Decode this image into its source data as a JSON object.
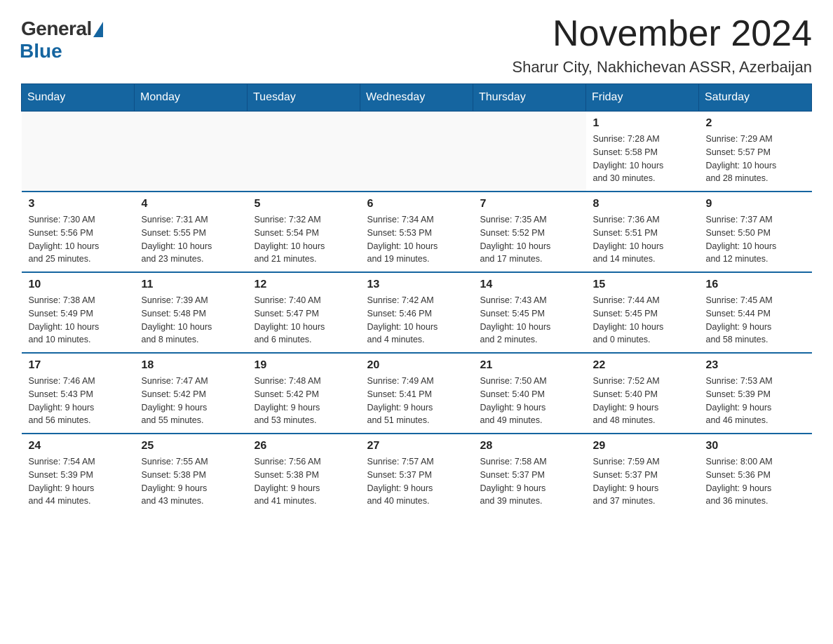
{
  "logo": {
    "general": "General",
    "blue": "Blue"
  },
  "title": "November 2024",
  "subtitle": "Sharur City, Nakhichevan ASSR, Azerbaijan",
  "weekdays": [
    "Sunday",
    "Monday",
    "Tuesday",
    "Wednesday",
    "Thursday",
    "Friday",
    "Saturday"
  ],
  "weeks": [
    [
      {
        "day": "",
        "info": ""
      },
      {
        "day": "",
        "info": ""
      },
      {
        "day": "",
        "info": ""
      },
      {
        "day": "",
        "info": ""
      },
      {
        "day": "",
        "info": ""
      },
      {
        "day": "1",
        "info": "Sunrise: 7:28 AM\nSunset: 5:58 PM\nDaylight: 10 hours\nand 30 minutes."
      },
      {
        "day": "2",
        "info": "Sunrise: 7:29 AM\nSunset: 5:57 PM\nDaylight: 10 hours\nand 28 minutes."
      }
    ],
    [
      {
        "day": "3",
        "info": "Sunrise: 7:30 AM\nSunset: 5:56 PM\nDaylight: 10 hours\nand 25 minutes."
      },
      {
        "day": "4",
        "info": "Sunrise: 7:31 AM\nSunset: 5:55 PM\nDaylight: 10 hours\nand 23 minutes."
      },
      {
        "day": "5",
        "info": "Sunrise: 7:32 AM\nSunset: 5:54 PM\nDaylight: 10 hours\nand 21 minutes."
      },
      {
        "day": "6",
        "info": "Sunrise: 7:34 AM\nSunset: 5:53 PM\nDaylight: 10 hours\nand 19 minutes."
      },
      {
        "day": "7",
        "info": "Sunrise: 7:35 AM\nSunset: 5:52 PM\nDaylight: 10 hours\nand 17 minutes."
      },
      {
        "day": "8",
        "info": "Sunrise: 7:36 AM\nSunset: 5:51 PM\nDaylight: 10 hours\nand 14 minutes."
      },
      {
        "day": "9",
        "info": "Sunrise: 7:37 AM\nSunset: 5:50 PM\nDaylight: 10 hours\nand 12 minutes."
      }
    ],
    [
      {
        "day": "10",
        "info": "Sunrise: 7:38 AM\nSunset: 5:49 PM\nDaylight: 10 hours\nand 10 minutes."
      },
      {
        "day": "11",
        "info": "Sunrise: 7:39 AM\nSunset: 5:48 PM\nDaylight: 10 hours\nand 8 minutes."
      },
      {
        "day": "12",
        "info": "Sunrise: 7:40 AM\nSunset: 5:47 PM\nDaylight: 10 hours\nand 6 minutes."
      },
      {
        "day": "13",
        "info": "Sunrise: 7:42 AM\nSunset: 5:46 PM\nDaylight: 10 hours\nand 4 minutes."
      },
      {
        "day": "14",
        "info": "Sunrise: 7:43 AM\nSunset: 5:45 PM\nDaylight: 10 hours\nand 2 minutes."
      },
      {
        "day": "15",
        "info": "Sunrise: 7:44 AM\nSunset: 5:45 PM\nDaylight: 10 hours\nand 0 minutes."
      },
      {
        "day": "16",
        "info": "Sunrise: 7:45 AM\nSunset: 5:44 PM\nDaylight: 9 hours\nand 58 minutes."
      }
    ],
    [
      {
        "day": "17",
        "info": "Sunrise: 7:46 AM\nSunset: 5:43 PM\nDaylight: 9 hours\nand 56 minutes."
      },
      {
        "day": "18",
        "info": "Sunrise: 7:47 AM\nSunset: 5:42 PM\nDaylight: 9 hours\nand 55 minutes."
      },
      {
        "day": "19",
        "info": "Sunrise: 7:48 AM\nSunset: 5:42 PM\nDaylight: 9 hours\nand 53 minutes."
      },
      {
        "day": "20",
        "info": "Sunrise: 7:49 AM\nSunset: 5:41 PM\nDaylight: 9 hours\nand 51 minutes."
      },
      {
        "day": "21",
        "info": "Sunrise: 7:50 AM\nSunset: 5:40 PM\nDaylight: 9 hours\nand 49 minutes."
      },
      {
        "day": "22",
        "info": "Sunrise: 7:52 AM\nSunset: 5:40 PM\nDaylight: 9 hours\nand 48 minutes."
      },
      {
        "day": "23",
        "info": "Sunrise: 7:53 AM\nSunset: 5:39 PM\nDaylight: 9 hours\nand 46 minutes."
      }
    ],
    [
      {
        "day": "24",
        "info": "Sunrise: 7:54 AM\nSunset: 5:39 PM\nDaylight: 9 hours\nand 44 minutes."
      },
      {
        "day": "25",
        "info": "Sunrise: 7:55 AM\nSunset: 5:38 PM\nDaylight: 9 hours\nand 43 minutes."
      },
      {
        "day": "26",
        "info": "Sunrise: 7:56 AM\nSunset: 5:38 PM\nDaylight: 9 hours\nand 41 minutes."
      },
      {
        "day": "27",
        "info": "Sunrise: 7:57 AM\nSunset: 5:37 PM\nDaylight: 9 hours\nand 40 minutes."
      },
      {
        "day": "28",
        "info": "Sunrise: 7:58 AM\nSunset: 5:37 PM\nDaylight: 9 hours\nand 39 minutes."
      },
      {
        "day": "29",
        "info": "Sunrise: 7:59 AM\nSunset: 5:37 PM\nDaylight: 9 hours\nand 37 minutes."
      },
      {
        "day": "30",
        "info": "Sunrise: 8:00 AM\nSunset: 5:36 PM\nDaylight: 9 hours\nand 36 minutes."
      }
    ]
  ]
}
